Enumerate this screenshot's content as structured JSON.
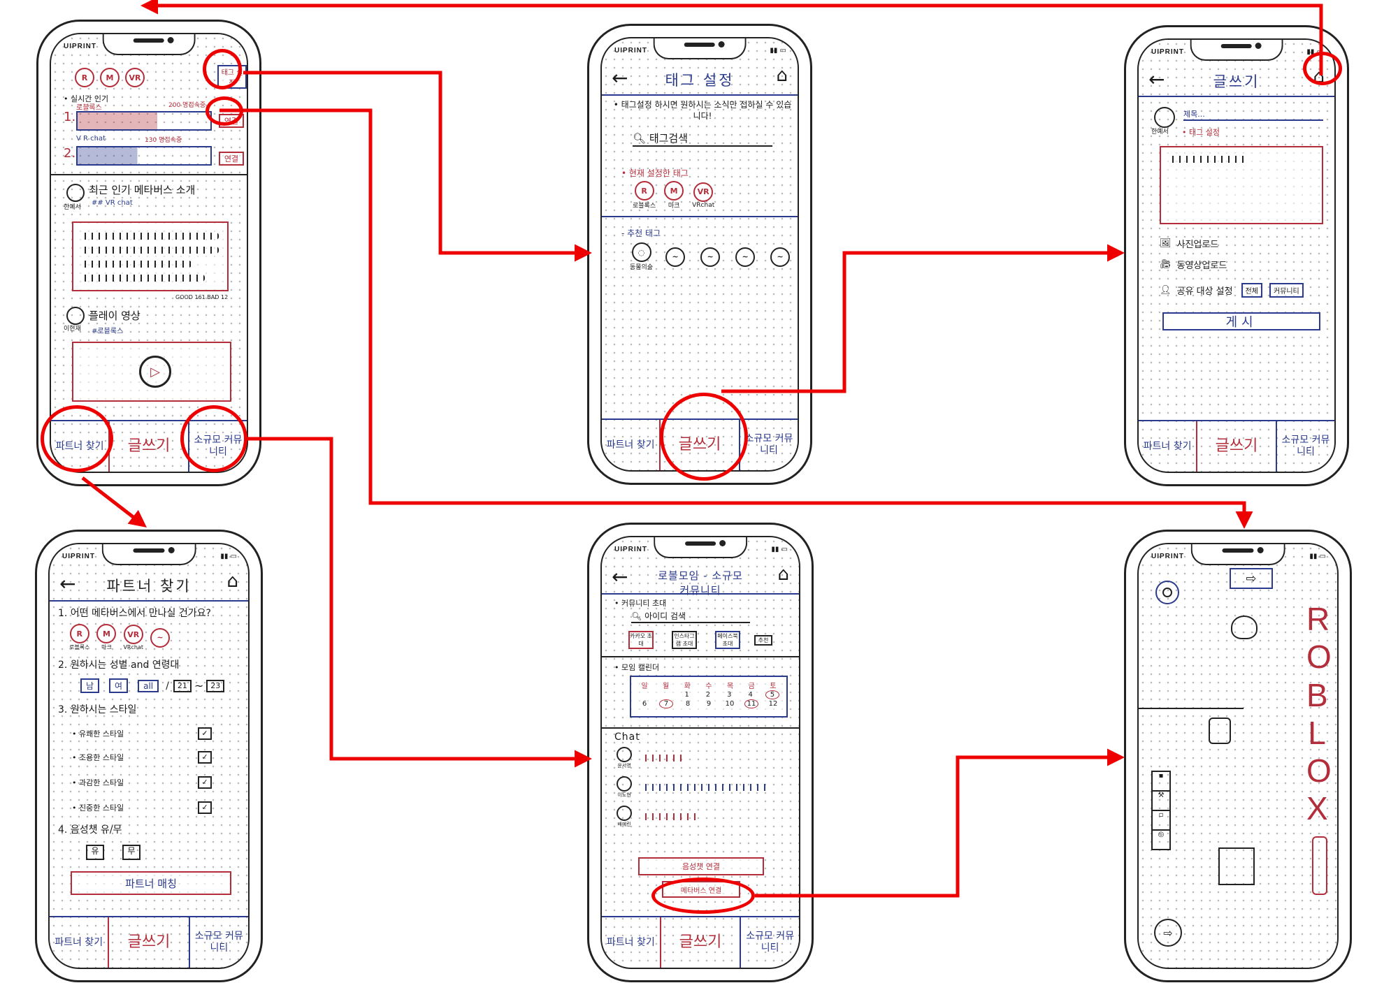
{
  "brand": "UIPRINT",
  "tabs": {
    "left": "파트너 찾기",
    "mid": "글쓰기",
    "right": "소규모 커뮤니티"
  },
  "screen1": {
    "tags": [
      "R",
      "M",
      "VR"
    ],
    "tag_button": "태그 설정",
    "section1_title": "• 실시간 인기",
    "rank1": "1.",
    "rank1_name": "로블록스",
    "rank1_count": "200 명접속중",
    "rank2": "2.",
    "rank2_name": "V R chat",
    "rank2_count": "130 명접속중",
    "connect1": "연결",
    "connect2": "연결",
    "post1_user": "한예서",
    "post1_title": "최근 인기 메타버스 소개",
    "post1_tag": "## VR chat",
    "post1_stats": "GOOD 161  BAD 12",
    "post2_user": "이현재",
    "post2_title": "플레이 영상",
    "post2_tag": "#로블록스"
  },
  "screen2": {
    "title": "태그 설정",
    "notice": "• 태그설정 하시면 원하시는 소식만 접하실 수 있습니다!",
    "search": "태그검색",
    "current_title": "• 현재 설정한 태그",
    "current_tags": [
      {
        "icon": "R",
        "label": "로블록스"
      },
      {
        "icon": "M",
        "label": "마크"
      },
      {
        "icon": "VR",
        "label": "VRchat"
      }
    ],
    "recommend_title": "- 추천 태그",
    "recommend_first": "동물의숲"
  },
  "screen3": {
    "title": "글쓰기",
    "user": "한예서",
    "title_placeholder": "제목...",
    "tag_setting": "• 태그 설정",
    "photo": "사진업로드",
    "video": "동영상업로드",
    "share": "공유 대상 설정",
    "share_all": "전체",
    "share_community": "커뮤니티",
    "post": "게시"
  },
  "screen4": {
    "title": "파트너 찾기",
    "q1": "1. 어떤 메타버스에서 만나실 건가요?",
    "q1_options": [
      {
        "icon": "R",
        "label": "로블록스"
      },
      {
        "icon": "M",
        "label": "마크"
      },
      {
        "icon": "VR",
        "label": "VRchat"
      },
      {
        "icon": "~",
        "label": ""
      }
    ],
    "q2": "2. 원하시는 성별 and 연령대",
    "q2_options": [
      "남",
      "여",
      "all"
    ],
    "age_from": "21",
    "age_to": "23",
    "q3": "3. 원하시는 스타일",
    "styles": [
      "• 유쾌한 스타일",
      "• 조용한 스타일",
      "• 과감한 스타일",
      "• 진중한 스타일"
    ],
    "q4": "4. 음성챗 유/무",
    "q4_options": [
      "유",
      "무"
    ],
    "match": "파트너 매칭"
  },
  "screen5": {
    "title": "로블모임 - 소규모 커뮤니티",
    "invite": "• 커뮤니티 초대",
    "search": "아이디 검색",
    "invite_buttons": [
      "카카오 초대",
      "인스타그램 초대",
      "페이스북 초대",
      "추천"
    ],
    "calendar_title": "• 모임 캘린더",
    "calendar_week": [
      "일",
      "월",
      "화",
      "수",
      "목",
      "금",
      "토"
    ],
    "calendar_row1": [
      "",
      "",
      "1",
      "2",
      "3",
      "4",
      "5"
    ],
    "calendar_row2": [
      "6",
      "7",
      "8",
      "9",
      "10",
      "11",
      "12"
    ],
    "chat_title": "Chat",
    "chat_users": [
      "윤서영",
      "이도현",
      "배예린"
    ],
    "voice": "음성챗 연결",
    "metaverse": "메타버스 연결"
  },
  "screen6": {
    "logo": "ROBLOX"
  },
  "colors": {
    "annotation": "#ee0000",
    "ink_red": "#b32d3a",
    "ink_blue": "#2a3a8c"
  }
}
